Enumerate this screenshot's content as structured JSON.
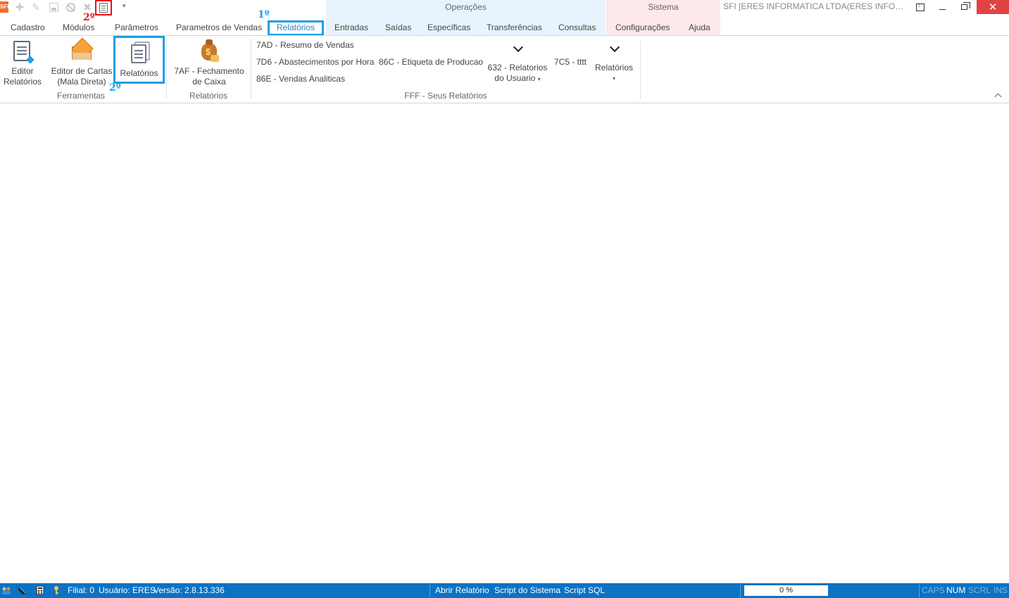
{
  "app": {
    "logo_text": "SFI",
    "window_title": "SFI [ERES INFORMATICA LTDA(ERES INFORMATICA LTDA)]"
  },
  "quick_access": {
    "more_glyph": "▾"
  },
  "annotations": {
    "step1": "1º",
    "step2_quick": "2º",
    "step2_ribbon": "2º"
  },
  "context_groups": {
    "operacoes": "Operações",
    "sistema": "Sistema"
  },
  "tabs": [
    {
      "label": "Cadastro"
    },
    {
      "label": "Módulos"
    },
    {
      "label": "Parâmetros"
    },
    {
      "label": "Parametros de Vendas"
    },
    {
      "label": "Relatórios",
      "selected": true
    },
    {
      "label": "Entradas"
    },
    {
      "label": "Saídas"
    },
    {
      "label": "Específicas"
    },
    {
      "label": "Transferências"
    },
    {
      "label": "Consultas"
    },
    {
      "label": "Configurações"
    },
    {
      "label": "Ajuda"
    }
  ],
  "ribbon": {
    "ferramentas": {
      "label": "Ferramentas",
      "editor_relatorios": [
        "Editor",
        "Relatórios"
      ],
      "editor_cartas": [
        "Editor de Cartas",
        "(Mala Direta)"
      ],
      "relatorios": "Relatórios"
    },
    "relatorios_group": {
      "label": "Relatórios",
      "fechamento": [
        "7AF - Fechamento",
        "de Caixa"
      ]
    },
    "seus_relatorios": {
      "label": "FFF - Seus Relatórios",
      "items": [
        "7AD - Resumo de Vendas",
        "7D6 - Abastecimentos por Hora",
        "86E - Vendas Analiticas",
        "86C - Etiqueta de Producao",
        "7C5 - tttt"
      ],
      "usuario_gallery": [
        "632 - Relatorios",
        "do Usuario"
      ],
      "relatorios_gallery": "Relatórios"
    }
  },
  "statusbar": {
    "filial": "Filial: 0",
    "usuario": "Usuário: ERES",
    "versao": "Versão: 2.8.13.336",
    "abrir_relatorio": "Abrir Relatório",
    "script_sistema": "Script do Sistema",
    "script_sql": "Script SQL",
    "progress_text": "0 %",
    "progress_value": 0,
    "caps": "CAPS",
    "num": "NUM",
    "scrl": "SCRL",
    "ins": "INS"
  }
}
